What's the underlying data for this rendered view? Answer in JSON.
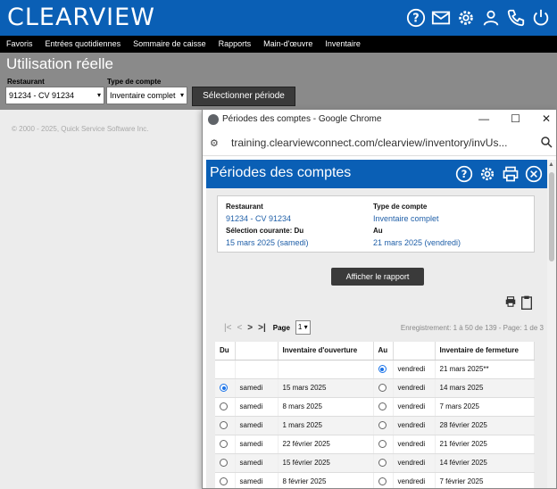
{
  "app": {
    "logo": "CLEARVIEW"
  },
  "header_icons": [
    "help-icon",
    "mail-icon",
    "gear-icon",
    "user-icon",
    "phone-icon",
    "power-icon"
  ],
  "nav": [
    "Favoris",
    "Entrées quotidiennes",
    "Sommaire de caisse",
    "Rapports",
    "Main-d'œuvre",
    "Inventaire"
  ],
  "page": {
    "title": "Utilisation réelle",
    "restaurant_label": "Restaurant",
    "restaurant_value": "91234 - CV 91234",
    "account_type_label": "Type de compte",
    "account_type_value": "Inventaire complet",
    "select_period_button": "Sélectionner période",
    "copyright": "© 2000 - 2025, Quick Service Software Inc."
  },
  "popup": {
    "window_title": "Périodes des comptes - Google Chrome",
    "url": "training.clearviewconnect.com/clearview/inventory/invUs...",
    "header_title": "Périodes des comptes",
    "info": {
      "restaurant_label": "Restaurant",
      "restaurant_value": "91234 - CV 91234",
      "account_type_label": "Type de compte",
      "account_type_value": "Inventaire complet",
      "current_from_label": "Sélection courante: Du",
      "current_from_value": "15 mars 2025 (samedi)",
      "to_label": "Au",
      "to_value": "21 mars 2025 (vendredi)"
    },
    "report_button": "Afficher le rapport",
    "pager": {
      "page_label": "Page",
      "page_value": "1",
      "records": "Enregistrement: 1 à 50 de 139 - Page: 1 de 3"
    },
    "table": {
      "headers": [
        "Du",
        "",
        "Inventaire d'ouverture",
        "Au",
        "",
        "Inventaire de fermeture"
      ],
      "rows": [
        {
          "from_selected": null,
          "from_day": "",
          "from_date": "",
          "to_selected": true,
          "to_day": "vendredi",
          "to_date": "21 mars 2025**"
        },
        {
          "from_selected": true,
          "from_day": "samedi",
          "from_date": "15 mars 2025",
          "to_selected": false,
          "to_day": "vendredi",
          "to_date": "14 mars 2025"
        },
        {
          "from_selected": false,
          "from_day": "samedi",
          "from_date": "8 mars 2025",
          "to_selected": false,
          "to_day": "vendredi",
          "to_date": "7 mars 2025"
        },
        {
          "from_selected": false,
          "from_day": "samedi",
          "from_date": "1 mars 2025",
          "to_selected": false,
          "to_day": "vendredi",
          "to_date": "28 février 2025"
        },
        {
          "from_selected": false,
          "from_day": "samedi",
          "from_date": "22 février 2025",
          "to_selected": false,
          "to_day": "vendredi",
          "to_date": "21 février 2025"
        },
        {
          "from_selected": false,
          "from_day": "samedi",
          "from_date": "15 février 2025",
          "to_selected": false,
          "to_day": "vendredi",
          "to_date": "14 février 2025"
        },
        {
          "from_selected": false,
          "from_day": "samedi",
          "from_date": "8 février 2025",
          "to_selected": false,
          "to_day": "vendredi",
          "to_date": "7 février 2025"
        }
      ]
    }
  },
  "colors": {
    "brand": "#0a5fb5",
    "link": "#1f5fa8"
  }
}
